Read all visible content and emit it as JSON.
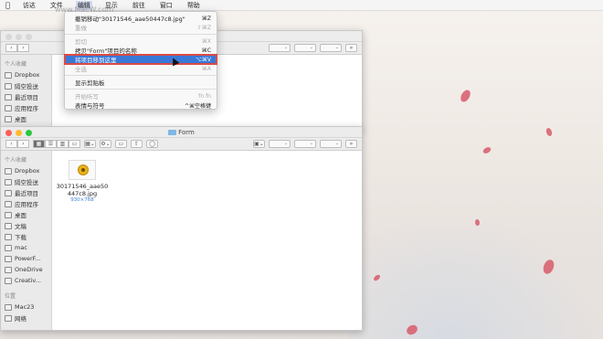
{
  "menubar": {
    "apple": "",
    "items": [
      "访达",
      "文件",
      "编辑",
      "显示",
      "前往",
      "窗口",
      "帮助"
    ]
  },
  "watermark": "www.MacW.com",
  "edit_menu": {
    "items": [
      {
        "label": "撤销移动\"30171546_aae50447c8.jpg\"",
        "shortcut": "⌘Z",
        "state": "normal"
      },
      {
        "label": "重做",
        "shortcut": "⇧⌘Z",
        "state": "disabled"
      },
      {
        "label": "剪切",
        "shortcut": "⌘X",
        "state": "disabled"
      },
      {
        "label": "拷贝\"Form\"项目的名称",
        "shortcut": "⌘C",
        "state": "normal"
      },
      {
        "label": "将项目移到这里",
        "shortcut": "⌥⌘V",
        "state": "selected"
      },
      {
        "label": "全选",
        "shortcut": "⌘A",
        "state": "disabled"
      },
      {
        "label": "显示剪贴板",
        "shortcut": "",
        "state": "normal"
      },
      {
        "label": "开始听写",
        "shortcut": "fn fn",
        "state": "disabled"
      },
      {
        "label": "表情与符号",
        "shortcut": "^⌘空格键",
        "state": "normal"
      }
    ]
  },
  "back_window": {
    "sidebar": {
      "section": "个人收藏",
      "items": [
        "Dropbox",
        "隔空投送",
        "最近项目",
        "应用程序",
        "桌面"
      ]
    }
  },
  "front_window": {
    "title": "Form",
    "sidebar": {
      "section": "个人收藏",
      "items": [
        "Dropbox",
        "隔空投送",
        "最近项目",
        "应用程序",
        "桌面",
        "文稿",
        "下载",
        "mac",
        "PowerF...",
        "OneDrive",
        "Creativ..."
      ],
      "section2": "位置",
      "items2": [
        "Mac23",
        "网络"
      ]
    },
    "file": {
      "name": "30171546_aae50447c8.jpg",
      "dimensions": "930×768"
    }
  },
  "colors": {
    "selection": "#3a78d8",
    "highlight_box": "#d94b45",
    "petal": "#d85a6b"
  }
}
